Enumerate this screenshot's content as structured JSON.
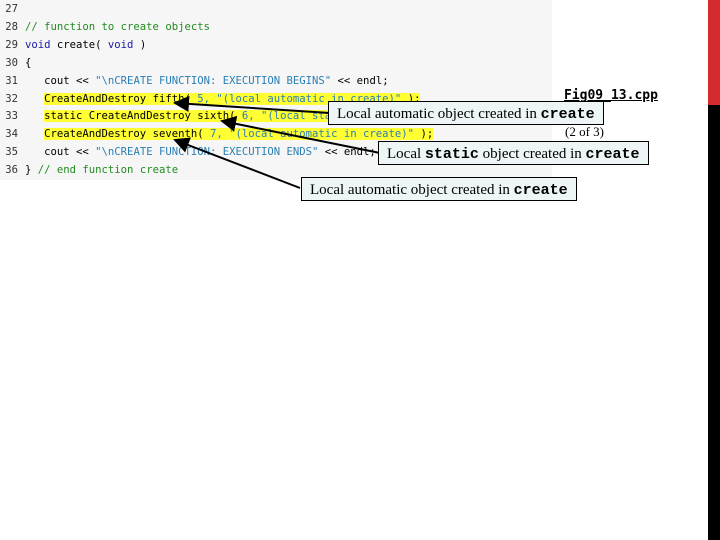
{
  "code": {
    "lines": [
      {
        "num": "27",
        "segments": []
      },
      {
        "num": "28",
        "segments": [
          {
            "cls": "cm",
            "text": "// function to create objects"
          }
        ]
      },
      {
        "num": "29",
        "segments": [
          {
            "cls": "kw",
            "text": "void"
          },
          {
            "cls": "plain",
            "text": " create( "
          },
          {
            "cls": "kw",
            "text": "void"
          },
          {
            "cls": "plain",
            "text": " )"
          }
        ]
      },
      {
        "num": "30",
        "segments": [
          {
            "cls": "plain",
            "text": "{"
          }
        ]
      },
      {
        "num": "31",
        "segments": [
          {
            "cls": "plain",
            "text": "   cout << "
          },
          {
            "cls": "st",
            "text": "\"\\nCREATE FUNCTION: EXECUTION BEGINS\""
          },
          {
            "cls": "plain",
            "text": " << endl;"
          }
        ]
      },
      {
        "num": "32",
        "highlight": true,
        "segments": [
          {
            "cls": "plain",
            "text": "   "
          },
          {
            "cls": "plain hl",
            "text": "CreateAndDestroy fifth( "
          },
          {
            "cls": "st hl",
            "text": "5, \"(local automatic in create)\""
          },
          {
            "cls": "plain hl",
            "text": " );"
          }
        ]
      },
      {
        "num": "33",
        "highlight": true,
        "segments": [
          {
            "cls": "plain",
            "text": "   "
          },
          {
            "cls": "plain hl",
            "text": "static CreateAndDestroy sixth( "
          },
          {
            "cls": "st hl",
            "text": "6, \"(local static in create)\""
          },
          {
            "cls": "plain hl",
            "text": " );"
          }
        ]
      },
      {
        "num": "34",
        "highlight": true,
        "segments": [
          {
            "cls": "plain",
            "text": "   "
          },
          {
            "cls": "plain hl",
            "text": "CreateAndDestroy seventh( "
          },
          {
            "cls": "st hl",
            "text": "7, \"(local automatic in create)\""
          },
          {
            "cls": "plain hl",
            "text": " );"
          }
        ]
      },
      {
        "num": "35",
        "segments": [
          {
            "cls": "plain",
            "text": "   cout << "
          },
          {
            "cls": "st",
            "text": "\"\\nCREATE FUNCTION: EXECUTION ENDS\""
          },
          {
            "cls": "plain",
            "text": " << endl;"
          }
        ]
      },
      {
        "num": "36",
        "segments": [
          {
            "cls": "plain",
            "text": "} "
          },
          {
            "cls": "cm",
            "text": "// end function create"
          }
        ]
      }
    ]
  },
  "figure": {
    "title": "Fig09_13.cpp",
    "page": "(2 of 3)"
  },
  "callouts": [
    {
      "prefix": "Local automatic object created in ",
      "mono": "create"
    },
    {
      "prefix": "Local ",
      "mono": "static",
      "suffix": " object created in ",
      "mono2": "create"
    },
    {
      "prefix": "Local automatic object created in ",
      "mono": "create"
    }
  ],
  "colors": {
    "accent_red": "#d52b2f",
    "highlight": "#ffff33",
    "keyword": "#1a1aa6",
    "comment": "#228b22",
    "string": "#2a7fb5",
    "callout_bg": "#eef5f6"
  }
}
